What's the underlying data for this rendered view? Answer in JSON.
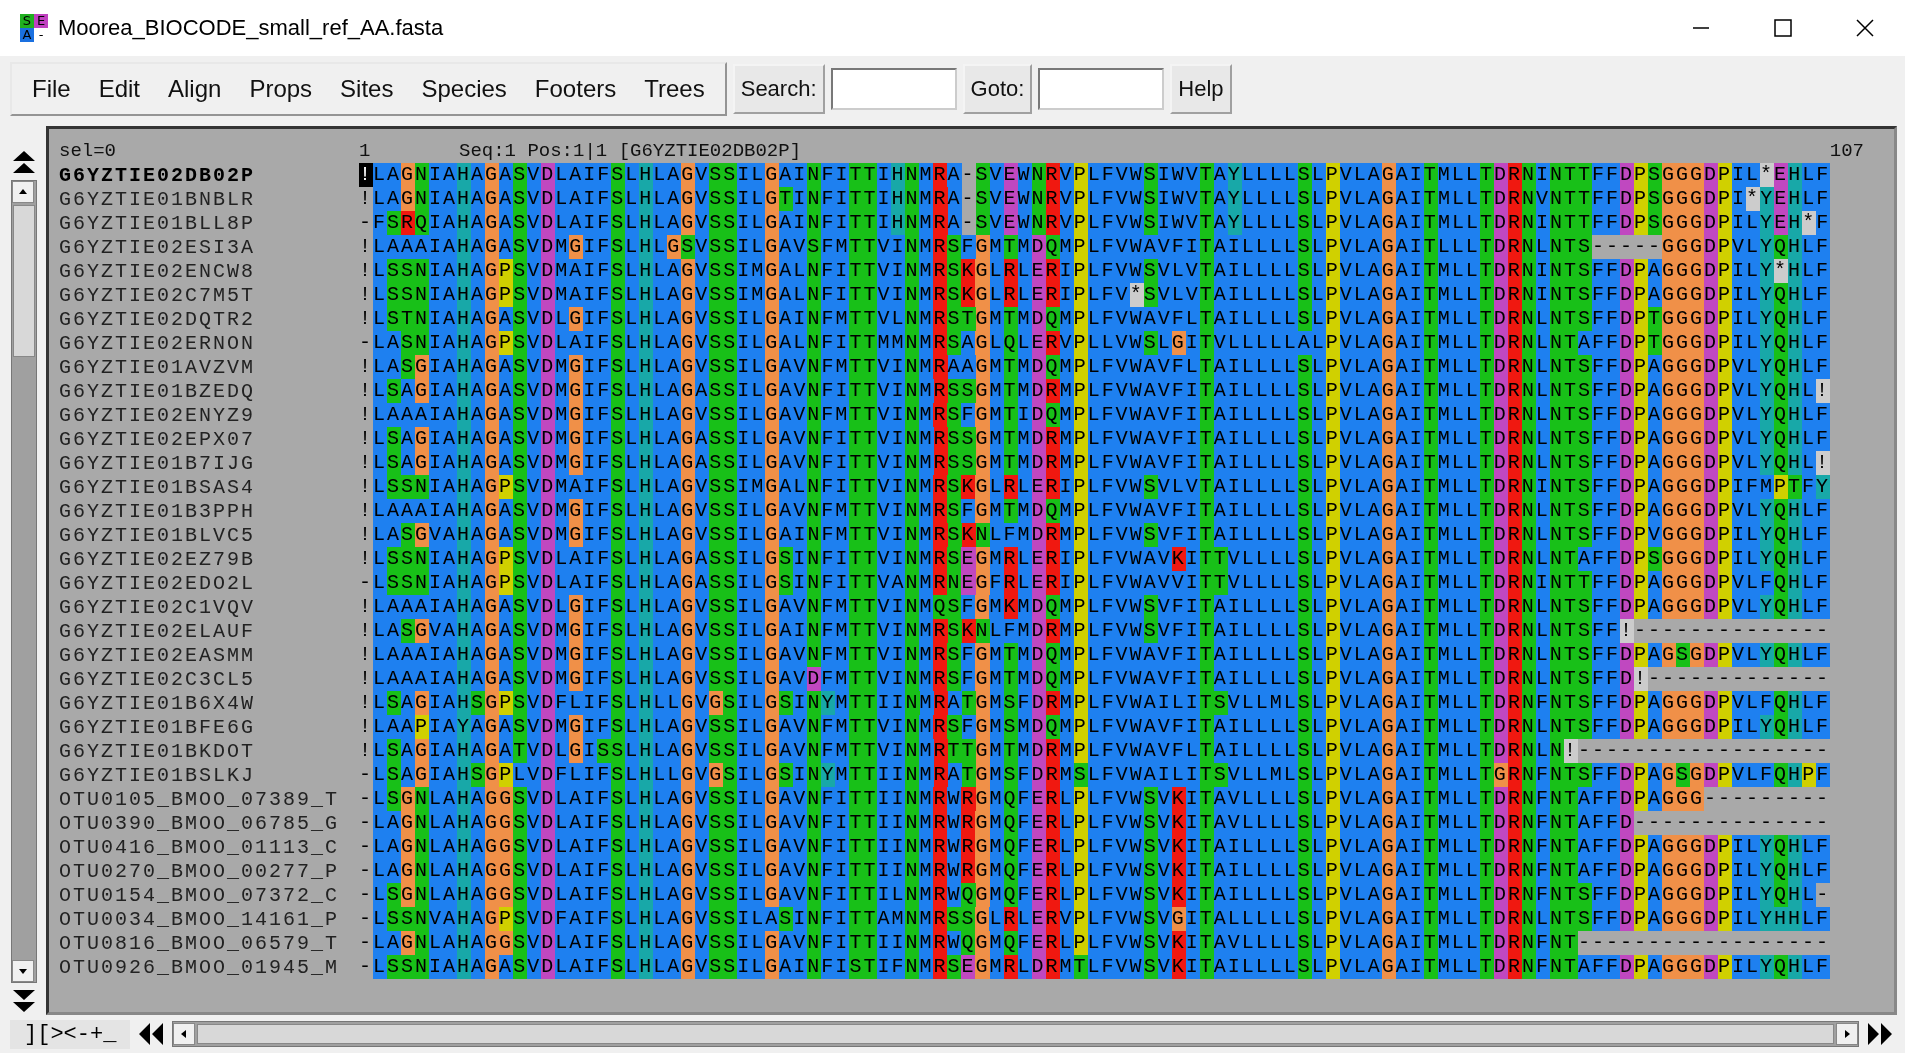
{
  "window": {
    "title": "Moorea_BIOCODE_small_ref_AA.fasta",
    "icon_letters": [
      "S",
      "E",
      "A",
      "-"
    ]
  },
  "menu": [
    "File",
    "Edit",
    "Align",
    "Props",
    "Sites",
    "Species",
    "Footers",
    "Trees"
  ],
  "search": {
    "label": "Search:"
  },
  "goto": {
    "label": "Goto:"
  },
  "help_button": "Help",
  "header": {
    "selection": "sel=0",
    "start": "1",
    "position": "Seq:1 Pos:1|1 [G6YZTIE02DB02P]",
    "end": "107"
  },
  "sequences": [
    {
      "name": "G6YZTIE02DB02P",
      "selected": true,
      "residues": "!LAGNIAHAGASVDLAIFSLHLAGVSSILGAINFITTIHNMRA-SVEWNRVPLFVWSIWVTAYLLLLSLPVLAGAITMLLTDRNINTTFFDPSGGGDPIL*EHLF"
    },
    {
      "name": "G6YZTIE01BNBLR",
      "selected": false,
      "residues": "!LAGNIAHAGASVDLAIFSLHLAGVSSILGTINFITTIHNMRA-SVEWNRVPLFVWSIWVTAYLLLLSLPVLAGAITMLLTDRNVNTTFFDPSGGGDPI*YEHLF"
    },
    {
      "name": "G6YZTIE01BLL8P",
      "selected": false,
      "residues": "-FSRQIAHAGASVDLAIFSLHLAGVSSILGAINFITTIHNMRA-SVEWNRVPLFVWSIWVTAYLLLLSLPVLAGAITMLLTDRNINTTFFDPSGGGDPILYEH*F"
    },
    {
      "name": "G6YZTIE02ESI3A",
      "selected": false,
      "residues": "!LAAAIAHAGASVDMGIFSLHLGSVSSILGAVSFMTTVINMRSFGMTMDQMPLFVWAVFITAILLLLSLPVLAGAITLLLTDRNLNTS-----GGGDPVLYQHLF"
    },
    {
      "name": "G6YZTIE02ENCW8",
      "selected": false,
      "residues": "!LSSNIAHAGPSVDMAIFSLHLAGVSSIMGALNFITTVINMRSKGLRLERIPLFVWSVLVTAILLLLSLPVLAGAITMLLTDRNINTSFFDPAGGGDPILY*HLF"
    },
    {
      "name": "G6YZTIE02C7M5T",
      "selected": false,
      "residues": "!LSSNIAHAGPSVDMAIFSLHLAGVSSIMGALNFITTVINMRSKGLRLERIPLFV*SVLVTAILLLLSLPVLAGAITMLLTDRNINTSFFDPAGGGDPILYQHLF"
    },
    {
      "name": "G6YZTIE02DQTR2",
      "selected": false,
      "residues": "!LSTNIAHAGASVDLGIFSLHLAGVSSILGAINFMTTVLNMRSTGMTMDQMPLFVWAVFLTAILLLLSLPVLAGAITMLLTDRNLNTSFFDPTGGGDPILYQHLF"
    },
    {
      "name": "G6YZTIE02ERNON",
      "selected": false,
      "residues": "-LASNIAHAGPSVDLAIFSLHLAGVSSILGALNFITTMMNMRSAGLQLERVPLLVWSLGITVLLLLLALPVLAGAITMLLTDRNLNTAFFDPTGGGDPILYQHLF"
    },
    {
      "name": "G6YZTIE01AVZVM",
      "selected": false,
      "residues": "!LASGIAHAGASVDMGIFSLHLAGVSSILGAVNFMTTVINMRAAGMTMDQMPLFVWAVFLTAILLLLSLPVLAGAITMLLTDRNLNTSFFDPAGGGDPVLYQHLF"
    },
    {
      "name": "G6YZTIE01BZEDQ",
      "selected": false,
      "residues": "!LSAGIAHAGASVDMGIFSLHLAGASSILGAVNFITTVINMRSSGMTMDRMPLFVWAVFITAILLLLSLPVLAGAITMLLTDRNLNTSFFDPAGGGDPVLYQHL!"
    },
    {
      "name": "G6YZTIE02ENYZ9",
      "selected": false,
      "residues": "!LAAAIAHAGASVDMGIFSLHLAGVSSILGAVNFMTTVINMRSFGMTIDQMPLFVWAVFITAILLLLSLPVLAGAITMLLTDRNLNTSFFDPAGGGDPVLYQHLF"
    },
    {
      "name": "G6YZTIE02EPX07",
      "selected": false,
      "residues": "!LSAGIAHAGASVDMGIFSLHLAGASSILGAVNFITTVINMRSSGMTMDRMPLFVWAVFITAILLLLSLPVLAGAITMLLTDRNLNTSFFDPAGGGDPVLYQHLF"
    },
    {
      "name": "G6YZTIE01B7IJG",
      "selected": false,
      "residues": "!LSAGIAHAGASVDMGIFSLHLAGASSILGAVNFITTVINMRSSGMTMDRMPLFVWAVFITAILLLLSLPVLAGAITMLLTDRNLNTSFFDPAGGGDPVLYQHL!"
    },
    {
      "name": "G6YZTIE01BSAS4",
      "selected": false,
      "residues": "!LSSNIAHAGPSVDMAIFSLHLAGVSSIMGALNFITTVINMRSKGLRLERIPLFVWSVLVTAILLLLSLPVLAGAITMLLTDRNINTSFFDPAGGGDPIFMPTFY"
    },
    {
      "name": "G6YZTIE01B3PPH",
      "selected": false,
      "residues": "!LAAAIAHAGASVDMGIFSLHLAGVSSILGAVNFMTTVINMRSFGMTMDQMPLFVWAVFITAILLLLSLPVLAGAITMLLTDRNLNTSFFDPAGGGDPVLYQHLF"
    },
    {
      "name": "G6YZTIE01BLVC5",
      "selected": false,
      "residues": "!LASGVAHAGASVDMGIFSLHLAGVSSILGAINFMTTVINMRSKNLFMDRMPLFVWSVFITAILLLLSLPVLAGAITMLLTDRNLNTSFFDPVGGGDPILYQHLF"
    },
    {
      "name": "G6YZTIE02EZ79B",
      "selected": false,
      "residues": "!LSSNIAHAGPSVDLAIFSLHLAGASSILGSINFITTVINMRSEGMRLERIPLFVWAVKITTVLLLLSLPVLAGAITMLLTDRNLNTAFFDPSGGGDPILYQHLF"
    },
    {
      "name": "G6YZTIE02EDO2L",
      "selected": false,
      "residues": "-LSSNIAHAGPSVDLAIFSLHLAGASSILGSINFITTVANMRNEGFRLERIPLFVWAVVITTVLLLLSLPVLAGAITMLLTDRNINTTFFDPAGGGDPVLFQHLF"
    },
    {
      "name": "G6YZTIE02C1VQV",
      "selected": false,
      "residues": "!LAAAIAHAGASVDLGIFSLHLAGVSSILGAVNFMTTVINMQSFGMKMDQMPLFVWSVFITAILLLLSLPVLAGAITMLLTDRNLNTSFFDPAGGGDPVLYQHLF"
    },
    {
      "name": "G6YZTIE02ELAUF",
      "selected": false,
      "residues": "!LASGVAHAGASVDMGIFSLHLAGVSSILGAINFMTTVINMRSKNLFMDRMPLFVWSVFITAILLLLSLPVLAGAITMLLTDRNLNTSFF!--------------"
    },
    {
      "name": "G6YZTIE02EASMM",
      "selected": false,
      "residues": "!LAAAIAHAGASVDMGIFSLHLAGVSSILGAVNFMTTVINMRSFGMTMDQMPLFVWAVFITAILLLLSLPVLAGAITMLLTDRNLNTSFFDPAGSGDPVLYQHLF"
    },
    {
      "name": "G6YZTIE02C3CL5",
      "selected": false,
      "residues": "!LAAAIAHAGASVDMGIFSLHLAGVSSILGAVDFMTTVINMRSFGMTMDQMPLFVWAVFITAILLLLSLPVLAGAITMLLTDRNLNTSFFD!-------------"
    },
    {
      "name": "G6YZTIE01B6X4W",
      "selected": false,
      "residues": "!LSAGIAHSGPSVDFLIFSLHLLGVGSILGSINYMTTIINMRATGMSFDRMPLFVWAILITSVLLMLSLPVLAGAITMLLTDRNFNTSFFDPAGGGDPVLFQHLF"
    },
    {
      "name": "G6YZTIE01BFE6G",
      "selected": false,
      "residues": "!LAAPIAYAGASVDMGIFSLHLAGVSSILGAVNFMTTVINMRSFGMSMDQMPLFVWAVFITAILLLLSLPVLAGAITMLLTDRNLNTSFFDPAGGGDPILYQHLF"
    },
    {
      "name": "G6YZTIE01BKDOT",
      "selected": false,
      "residues": "!LSAGIAHAGATVDLGISSLHLAGVSSILGAVNFMTTVINMRTTGMTMDRMPLFVWAVFLTAILLLLSLPVLAGAITMLLTDRNLN!------------------"
    },
    {
      "name": "G6YZTIE01BSLKJ",
      "selected": false,
      "residues": "-LSAGIAHSGPLVDFLIFSLHLLGVGSILGSINYMTTIINMRATGMSFDRMSLFVWAILITSVLLMLSLPVLAGAITMLLTGRNFNTSFFDPAGSGDPVLFQHPF"
    },
    {
      "name": "OTU0105_BMOO_07389_T",
      "selected": false,
      "residues": "-LSGNLAHAGGSVDLAIFSLHLAGVSSILGAVNFITTIINMRWRGMQFERLPLFVWSVKITAVLLLLSLPVLAGAITMLLTDRNFNTAFFDPAGGG---------"
    },
    {
      "name": "OTU0390_BMOO_06785_G",
      "selected": false,
      "residues": "-LAGNLAHAGGSVDLAIFSLHLAGVSSILGAVNFITTIINMRWRGMQFERLPLFVWSVKITAVLLLLSLPVLAGAITMLLTDRNFNTAFFD--------------"
    },
    {
      "name": "OTU0416_BMOO_01113_C",
      "selected": false,
      "residues": "-LAGNLAHAGGSVDLAIFSLHLAGVSSILGAVNFITTIINMRWRGMQFERLPLFVWSVKITAILLLLSLPVLAGAITMLLTDRNFNTAFFDPAGGGDPILYQHLF"
    },
    {
      "name": "OTU0270_BMOO_00277_P",
      "selected": false,
      "residues": "-LAGNLAHAGGSVDLAIFSLHLAGVSSILGAVNFITTIINMRWRGMQFERLPLFVWSVKITAILLLLSLPVLAGAITMLLTDRNFNTAFFDPAGGGDPILYQHLF"
    },
    {
      "name": "OTU0154_BMOO_07372_C",
      "selected": false,
      "residues": "-LSGNLAHAGGSVDLAIFSLHLAGVSSILGAVNFITTILNMRWQGMQFERLPLFVWSVKITAILLLLSLPVLAGAITMLLTDRNFNTSFFDPAGGGDPILYQHL-"
    },
    {
      "name": "OTU0034_BMOO_14161_P",
      "selected": false,
      "residues": "-LSSNVAHAGPSVDFAIFSLHLAGVSSILASINFITTAMNMRSSGLRLERVPLFVWSVGITALLLLLSLPVLAGAITMLLTDRNLNTSFFDPAGGGDPILYHHLF"
    },
    {
      "name": "OTU0816_BMOO_06579_T",
      "selected": false,
      "residues": "-LAGNLAHAGGSVDLAIFSLHLAGVSSILGAVNFITTIINMRWQGMQFERLPLFVWSVKITAVLLLLSLPVLAGAITMLLTDRNFNT------------------"
    },
    {
      "name": "OTU0926_BMOO_01945_M",
      "selected": false,
      "residues": "-LSSNIAHAGASVDLAIFSLHLAGVSSILGAINFISTIFNMRSEGMRLDRMTLFVWSVKITAILLLLSLPVLAGAITMLLTDRNFNTAFFDPAGGGDPILYQHLF"
    }
  ],
  "footer": {
    "mode_label": "][><-+_"
  }
}
